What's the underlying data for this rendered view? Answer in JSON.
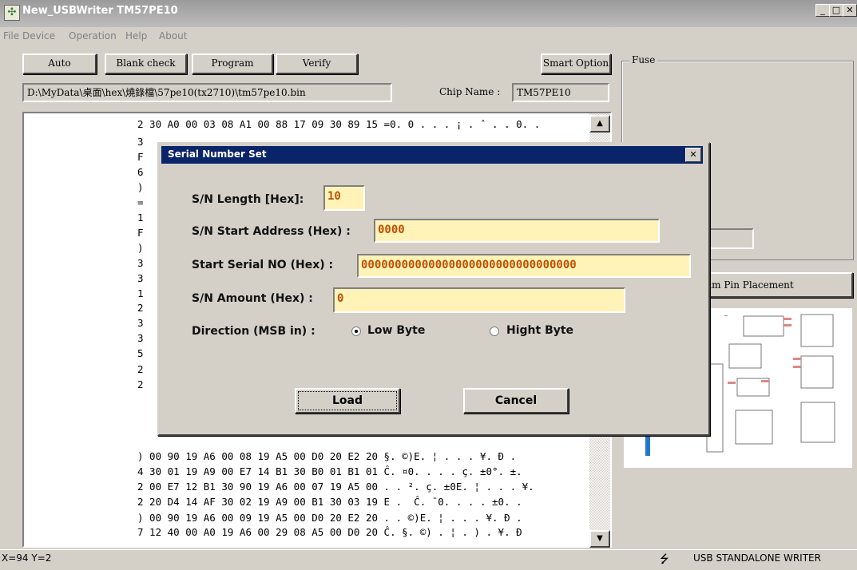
{
  "window": {
    "title": "New_USBWriter  TM57PE10"
  },
  "menu": [
    "File",
    "Device",
    "Operation",
    "Help",
    "About"
  ],
  "toolbar": {
    "auto": "Auto",
    "blank_check": "Blank check",
    "program": "Program",
    "verify": "Verify",
    "smart_option": "Smart Option"
  },
  "file_path": "D:\\MyData\\桌面\\hex\\燒錄檔\\57pe10(tx2710)\\tm57pe10.bin",
  "chip": {
    "label": "Chip Name :",
    "value": "TM57PE10"
  },
  "fuse": {
    "label": "Fuse"
  },
  "pin_placement_label": "am Pin Placement",
  "hex_rows": [
    "2 30 A0 00 03 08 A1 00 88 17 09 30 89 15 =0. 0 . . . ¡ . ˆ . . 0. .",
    "3",
    "F",
    "6",
    ")",
    "=",
    "1",
    "F",
    ")",
    "3",
    "3",
    "1",
    "2",
    "3",
    "3",
    "5",
    "2",
    "2",
    ") 00 90 19 A6 00 08 19 A5 00 D0 20 E2 20 §. ©)E. ¦ . . . ¥. Ð .",
    "4 30 01 19 A9 00 E7 14 B1 30 B0 01 B1 01 Ĉ. ¤0. . . . ç. ±0°. ±.",
    "2 00 E7 12 B1 30 90 19 A6 00 07 19 A5 00 . . ². ç. ±0E. ¦ . . . ¥.",
    "2 20 D4 14 AF 30 02 19 A9 00 B1 30 03 19 E .  Ĉ. ¯0. . . . ±0. .",
    ") 00 90 19 A6 00 09 19 A5 00 D0 20 E2 20 . . ©)E. ¦ . . . ¥. Ð .",
    "7 12 40 00 A0 19 A6 00 29 08 A5 00 D0 20 Ĉ. §. ©) . ¦ . ) . ¥. Ð"
  ],
  "dialog": {
    "title": "Serial Number Set",
    "sn_length_label": "S/N Length [Hex]:",
    "sn_length_value": "10",
    "sn_start_label": "S/N Start Address (Hex) :",
    "sn_start_value": "0000",
    "start_serial_label": "Start Serial NO (Hex) :",
    "start_serial_value": "00000000000000000000000000000000",
    "amount_label": "S/N Amount (Hex) :",
    "amount_value": "0",
    "direction_label": "Direction (MSB in) :",
    "low_byte": "Low Byte",
    "high_byte": "Hight Byte",
    "direction_selected": "Low Byte",
    "load": "Load",
    "cancel": "Cancel"
  },
  "status": {
    "coords": "X=94 Y=2",
    "device": "USB STANDALONE WRITER"
  }
}
